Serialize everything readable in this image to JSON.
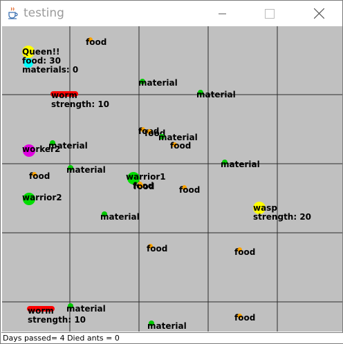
{
  "window": {
    "title": "testing",
    "icon": "java-cup-icon"
  },
  "controls": {
    "minimize_icon": "minimize-icon",
    "maximize_icon": "maximize-icon",
    "close_icon": "close-icon"
  },
  "colors": {
    "background": "#c0c0c0",
    "grid": "#2b2b2b",
    "food": "#ffa500",
    "material": "#00c800",
    "queen": "#ffff00",
    "queen_accent": "#00ffff",
    "worker": "#e000e0",
    "warrior": "#00dd00",
    "worm": "#ff0000",
    "wasp": "#ffff00"
  },
  "world": {
    "entities": [
      {
        "kind": "queen",
        "lines": [
          "Queen!!",
          "food: 30",
          " materials: 0"
        ]
      },
      {
        "kind": "worm",
        "lines": [
          "worm",
          "strength: 10"
        ]
      },
      {
        "kind": "worm",
        "lines": [
          "worm",
          "strength: 10"
        ]
      },
      {
        "kind": "worker",
        "lines": [
          "worker2"
        ]
      },
      {
        "kind": "warrior",
        "lines": [
          "warrior1"
        ]
      },
      {
        "kind": "warrior",
        "lines": [
          "warrior2"
        ]
      },
      {
        "kind": "wasp",
        "lines": [
          "wasp",
          "strength: 20"
        ]
      },
      {
        "kind": "food",
        "lines": [
          "food"
        ]
      },
      {
        "kind": "food",
        "lines": [
          "food"
        ]
      },
      {
        "kind": "food",
        "lines": [
          "food"
        ]
      },
      {
        "kind": "food",
        "lines": [
          "food"
        ]
      },
      {
        "kind": "food",
        "lines": [
          "food"
        ]
      },
      {
        "kind": "food",
        "lines": [
          "food"
        ]
      },
      {
        "kind": "food",
        "lines": [
          "food"
        ]
      },
      {
        "kind": "food",
        "lines": [
          "food"
        ]
      },
      {
        "kind": "food",
        "lines": [
          "food"
        ]
      },
      {
        "kind": "food",
        "lines": [
          "food"
        ]
      },
      {
        "kind": "food",
        "lines": [
          "food"
        ]
      },
      {
        "kind": "material",
        "lines": [
          "material"
        ]
      },
      {
        "kind": "material",
        "lines": [
          "material"
        ]
      },
      {
        "kind": "material",
        "lines": [
          "material"
        ]
      },
      {
        "kind": "material",
        "lines": [
          "material"
        ]
      },
      {
        "kind": "material",
        "lines": [
          "material"
        ]
      },
      {
        "kind": "material",
        "lines": [
          "material"
        ]
      },
      {
        "kind": "material",
        "lines": [
          "material"
        ]
      },
      {
        "kind": "material",
        "lines": [
          "material"
        ]
      },
      {
        "kind": "material",
        "lines": [
          "material"
        ]
      }
    ]
  },
  "status": {
    "text": "Days passed= 4  Died ants = 0"
  }
}
